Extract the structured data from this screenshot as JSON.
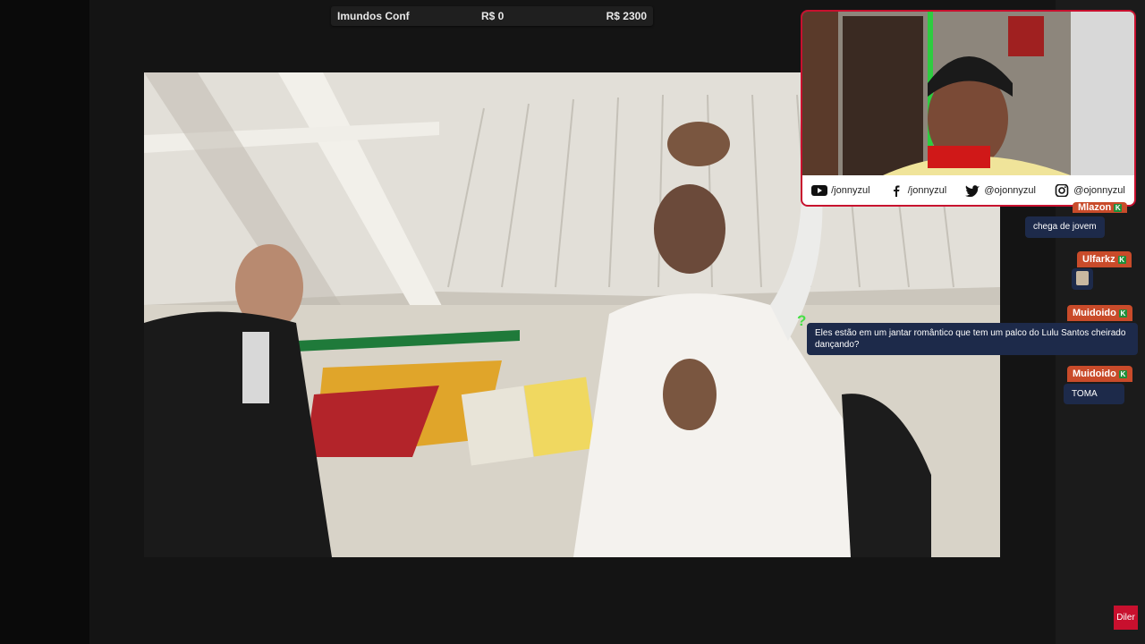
{
  "goal": {
    "title": "Imundos Conf",
    "current": "R$ 0",
    "target": "R$ 2300"
  },
  "video": {
    "scene": "film-still-two-men-low-angle"
  },
  "webcam": {
    "socials": [
      {
        "icon": "youtube-icon",
        "handle": "/jonnyzul"
      },
      {
        "icon": "facebook-icon",
        "handle": "/jonnyzul"
      },
      {
        "icon": "twitter-icon",
        "handle": "@ojonnyzul"
      },
      {
        "icon": "instagram-icon",
        "handle": "@ojonnyzul"
      }
    ]
  },
  "chat": {
    "messages": [
      {
        "user": "Mlazon",
        "text": "chega de jovem"
      },
      {
        "user": "Ulfarkz",
        "text": ""
      },
      {
        "user": "Muidoido",
        "text": "Eles estão em um jantar romântico que tem um palco do Lulu Santos cheirado dançando?"
      },
      {
        "user": "Muidoido",
        "text": "TOMA"
      }
    ],
    "badge_glyph": "K",
    "question_glyph": "?"
  },
  "corner": {
    "label": "Diler"
  },
  "colors": {
    "username_bg": "#c94b2a",
    "message_bg": "#1d2a4a",
    "badge_green": "#1f8f3a",
    "webcam_border": "#c8102e"
  }
}
